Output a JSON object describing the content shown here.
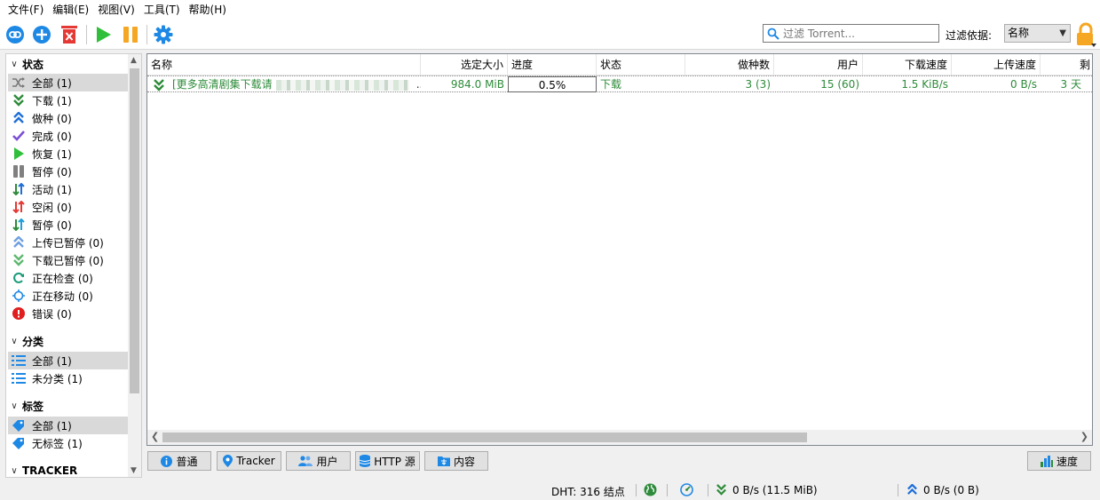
{
  "menu": [
    "文件(F)",
    "编辑(E)",
    "视图(V)",
    "工具(T)",
    "帮助(H)"
  ],
  "toolbar": {
    "filter_placeholder": "过滤 Torrent...",
    "filter_label": "过滤依据:",
    "filter_value": "名称"
  },
  "sidebar": {
    "status_title": "状态",
    "status_items": [
      "全部 (1)",
      "下载 (1)",
      "做种 (0)",
      "完成 (0)",
      "恢复 (1)",
      "暂停 (0)",
      "活动 (1)",
      "空闲 (0)",
      "暂停 (0)",
      "上传已暂停 (0)",
      "下载已暂停 (0)",
      "正在检查 (0)",
      "正在移动 (0)",
      "错误 (0)"
    ],
    "category_title": "分类",
    "category_items": [
      "全部 (1)",
      "未分类 (1)"
    ],
    "tags_title": "标签",
    "tag_items": [
      "全部 (1)",
      "无标签 (1)"
    ],
    "tracker_title": "TRACKER"
  },
  "table": {
    "columns": [
      "名称",
      "选定大小",
      "进度",
      "状态",
      "做种数",
      "用户",
      "下载速度",
      "上传速度",
      "剩"
    ],
    "rows": [
      {
        "name": "[更多高清剧集下载请",
        "name_suffix": "...",
        "size": "984.0 MiB",
        "progress": "0.5%",
        "progress_value": 0.005,
        "state": "下载",
        "seeds": "3 (3)",
        "peers": "15 (60)",
        "dl_speed": "1.5 KiB/s",
        "ul_speed": "0 B/s",
        "eta": "3 天"
      }
    ]
  },
  "tabs": {
    "general": "普通",
    "trackers": "Tracker",
    "peers": "用户",
    "http": "HTTP 源",
    "content": "内容",
    "speed": "速度"
  },
  "status": {
    "dht": "DHT: 316 结点",
    "download": "0 B/s (11.5 MiB)",
    "upload": "0 B/s (0 B)"
  },
  "colors": {
    "accent_blue": "#1e88e5",
    "download_green": "#2e8b3a",
    "delete_red": "#e53935",
    "resume_green": "#2fbf3a",
    "pause_orange": "#f5a623"
  }
}
